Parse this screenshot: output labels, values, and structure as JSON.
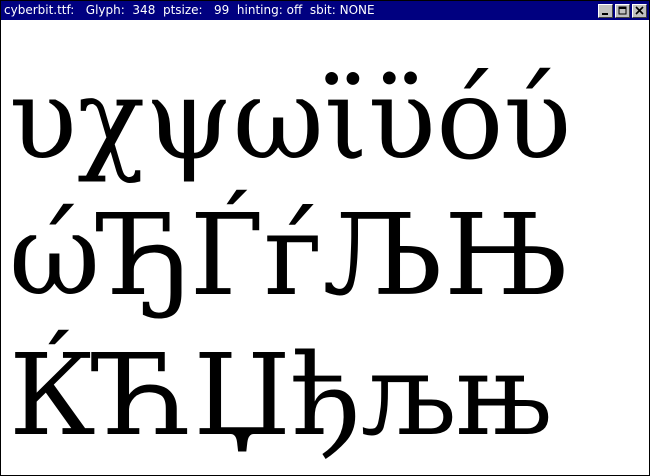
{
  "window": {
    "title": "cyberbit.ttf:   Glyph:  348  ptsize:   99  hinting: off  sbit: NONE",
    "buttons": {
      "minimize_icon": "minimize-icon",
      "maximize_icon": "maximize-icon",
      "close_icon": "close-icon"
    }
  },
  "glyphs": {
    "rows": [
      "υχψωϊϋόύ",
      "ώЂЃѓЉЊ",
      "ЌЋЏђљњ"
    ]
  },
  "colors": {
    "titlebar": "#000080",
    "title_text": "#ffffff",
    "background": "#ffffff",
    "glyph": "#000000"
  }
}
